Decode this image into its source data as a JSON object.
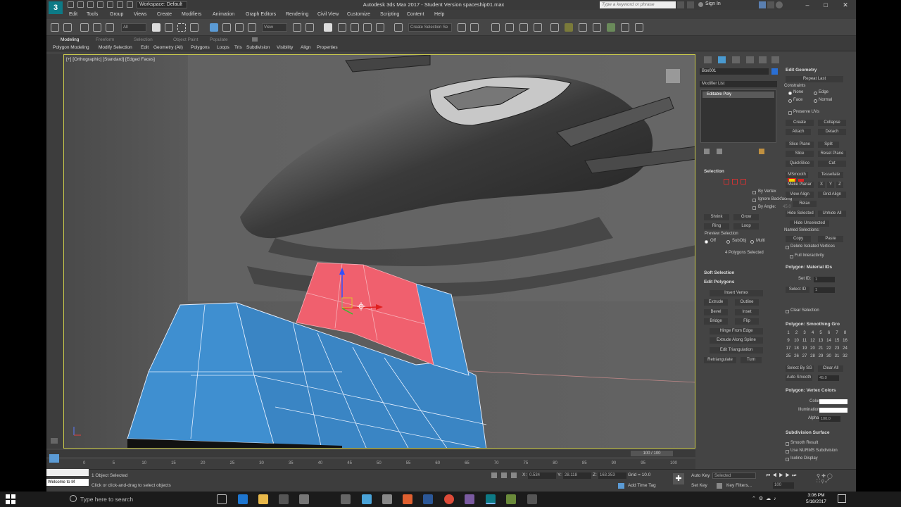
{
  "titlebar": {
    "workspace": "Workspace: Default",
    "title": "Autodesk 3ds Max 2017 - Student Version   spaceship01.max",
    "search_placeholder": "Type a keyword or phrase",
    "sign_in": "Sign In"
  },
  "menu": [
    "Edit",
    "Tools",
    "Group",
    "Views",
    "Create",
    "Modifiers",
    "Animation",
    "Graph Editors",
    "Rendering",
    "Civil View",
    "Customize",
    "Scripting",
    "Content",
    "Help"
  ],
  "toolbar": {
    "filter_value": "All",
    "refcoord_value": "View",
    "selection_set_placeholder": "Create Selection Se"
  },
  "ribbon": {
    "tabs": [
      "Modeling",
      "Freeform",
      "Selection",
      "Object Paint",
      "Populate"
    ],
    "subtabs": [
      "Polygon Modeling",
      "Modify Selection",
      "Edit",
      "Geometry (All)",
      "Polygons",
      "Loops",
      "Tris",
      "Subdivision",
      "Visibility",
      "Align",
      "Properties"
    ]
  },
  "viewport": {
    "label": "[+] [Orthographic] [Standard] [Edged Faces]"
  },
  "command_panel": {
    "object_name": "Box001",
    "modifier_list": "Modifier List",
    "stack_item": "Editable Poly",
    "selection": {
      "title": "Selection",
      "by_vertex": "By Vertex",
      "ignore_backfacing": "Ignore Backfacing",
      "by_angle": "By Angle:",
      "angle_value": "45.0",
      "shrink": "Shrink",
      "grow": "Grow",
      "ring": "Ring",
      "loop": "Loop",
      "preview_selection": "Preview Selection",
      "off": "Off",
      "subobj": "SubObj",
      "multi": "Multi",
      "status": "4 Polygons Selected"
    },
    "soft_selection": "Soft Selection",
    "edit_polygons": {
      "title": "Edit Polygons",
      "insert_vertex": "Insert Vertex",
      "extrude": "Extrude",
      "outline": "Outline",
      "bevel": "Bevel",
      "inset": "Inset",
      "bridge": "Bridge",
      "flip": "Flip",
      "hinge": "Hinge From Edge",
      "extrude_spline": "Extrude Along Spline",
      "edit_triangulation": "Edit Triangulation",
      "retriangulate": "Retriangulate",
      "turn": "Turn"
    },
    "edit_geometry": {
      "title": "Edit Geometry",
      "repeat_last": "Repeat Last",
      "constraints": "Constraints",
      "none": "None",
      "edge": "Edge",
      "face": "Face",
      "normal": "Normal",
      "preserve_uvs": "Preserve UVs",
      "create": "Create",
      "collapse": "Collapse",
      "attach": "Attach",
      "detach": "Detach",
      "slice_plane": "Slice Plane",
      "split": "Split",
      "slice": "Slice",
      "reset_plane": "Reset Plane",
      "quickslice": "QuickSlice",
      "cut": "Cut",
      "msmooth": "MSmooth",
      "tessellate": "Tessellate",
      "make_planar": "Make Planar",
      "x": "X",
      "y": "Y",
      "z": "Z",
      "view_align": "View Align",
      "grid_align": "Grid Align",
      "relax": "Relax",
      "hide_selected": "Hide Selected",
      "unhide_all": "Unhide All",
      "hide_unselected": "Hide Unselected",
      "named_selections": "Named Selections:",
      "copy": "Copy",
      "paste": "Paste",
      "delete_isolated": "Delete Isolated Vertices",
      "full_interactivity": "Full Interactivity"
    },
    "material_ids": {
      "title": "Polygon: Material IDs",
      "set_id": "Set ID:",
      "set_id_value": "1",
      "select_id": "Select ID",
      "select_id_value": "1",
      "clear_selection": "Clear Selection"
    },
    "smoothing_groups": {
      "title": "Polygon: Smoothing Gro",
      "numbers": [
        "1",
        "2",
        "3",
        "4",
        "5",
        "6",
        "7",
        "8",
        "9",
        "10",
        "11",
        "12",
        "13",
        "14",
        "15",
        "16",
        "17",
        "18",
        "19",
        "20",
        "21",
        "22",
        "23",
        "24",
        "25",
        "26",
        "27",
        "28",
        "29",
        "30",
        "31",
        "32"
      ],
      "select_by_sg": "Select By SG",
      "clear_all": "Clear All",
      "auto_smooth": "Auto Smooth",
      "auto_smooth_value": "45.0"
    },
    "vertex_colors": {
      "title": "Polygon: Vertex Colors",
      "color": "Color:",
      "illumination": "Illumination:",
      "alpha": "Alpha:",
      "alpha_value": "100.0"
    },
    "subdivision": {
      "title": "Subdivision Surface",
      "smooth_result": "Smooth Result",
      "use_nurms": "Use NURMS Subdivision",
      "isoline": "Isoline Display"
    }
  },
  "timeline": {
    "frame_counter": "100 / 100",
    "ticks": [
      "0",
      "5",
      "10",
      "15",
      "20",
      "25",
      "30",
      "35",
      "40",
      "45",
      "50",
      "55",
      "60",
      "65",
      "70",
      "75",
      "80",
      "85",
      "90",
      "95",
      "100"
    ]
  },
  "status": {
    "maxscript_prompt": "Welcome to M",
    "objects_selected": "1 Object Selected",
    "hint": "Click or click-and-drag to select objects",
    "x_label": "X:",
    "x_value": "0.534",
    "y_label": "Y:",
    "y_value": "28.118",
    "z_label": "Z:",
    "z_value": "163.353",
    "grid": "Grid = 10.0",
    "add_time_tag": "Add Time Tag",
    "auto_key": "Auto Key",
    "set_key": "Set Key",
    "selected_value": "Selected",
    "key_filters": "Key Filters...",
    "frame_value": "100"
  },
  "taskbar": {
    "search_placeholder": "Type here to search",
    "time": "3:06 PM",
    "date": "5/18/2017"
  },
  "colors": {
    "selected_polygons": "#f0606e",
    "unselected_polygons": "#3f8fd0",
    "viewport_border": "#c9c94c",
    "accent": "#0d7a86"
  }
}
